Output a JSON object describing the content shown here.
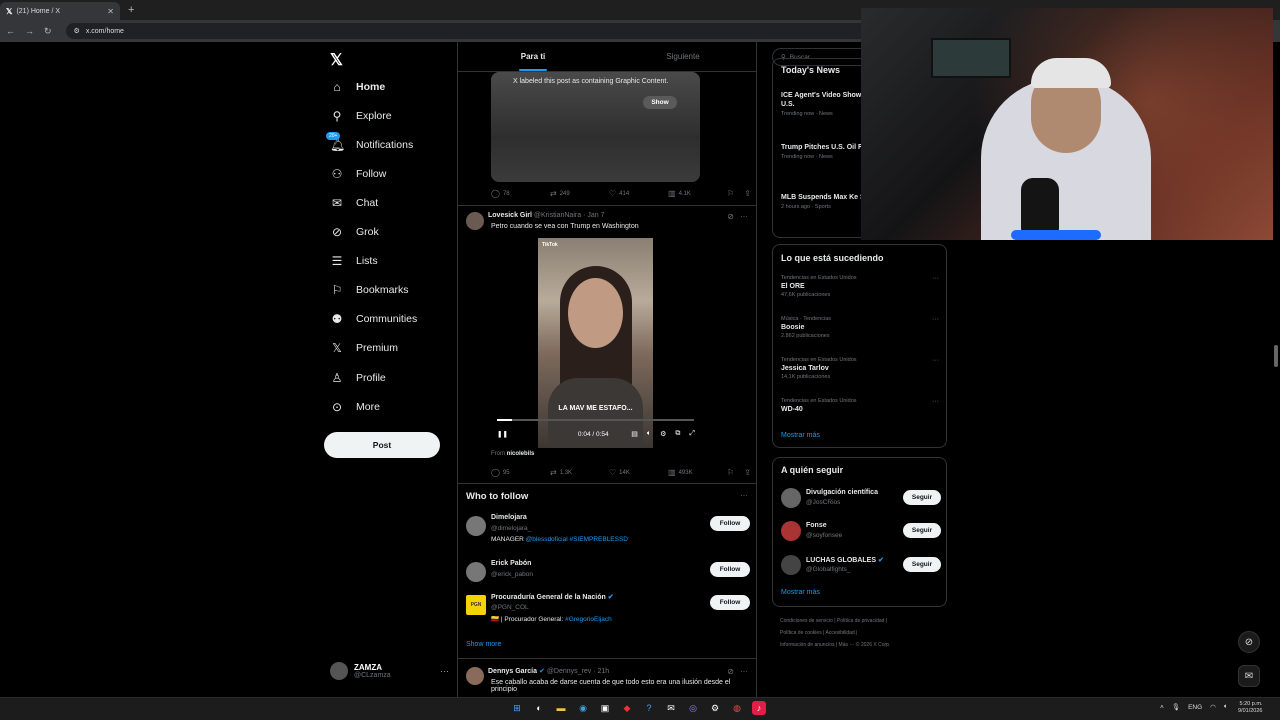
{
  "browser": {
    "tab_title": "(21) Home / X",
    "url": "x.com/home"
  },
  "nav": {
    "items": [
      {
        "label": "Home",
        "icon": "home-icon"
      },
      {
        "label": "Explore",
        "icon": "search-icon"
      },
      {
        "label": "Notifications",
        "icon": "bell-icon",
        "badge": "20+"
      },
      {
        "label": "Follow",
        "icon": "person-plus-icon"
      },
      {
        "label": "Chat",
        "icon": "mail-icon"
      },
      {
        "label": "Grok",
        "icon": "grok-icon"
      },
      {
        "label": "Lists",
        "icon": "list-icon"
      },
      {
        "label": "Bookmarks",
        "icon": "bookmark-icon"
      },
      {
        "label": "Communities",
        "icon": "people-icon"
      },
      {
        "label": "Premium",
        "icon": "x-icon"
      },
      {
        "label": "Profile",
        "icon": "person-icon"
      },
      {
        "label": "More",
        "icon": "more-circle-icon"
      }
    ],
    "post_label": "Post",
    "account": {
      "name": "ZAMZA",
      "handle": "@CLzamza"
    }
  },
  "feed": {
    "tabs": [
      "Para ti",
      "Siguiente"
    ],
    "graphic_post": {
      "notice": "X labeled this post as containing Graphic Content.",
      "show_label": "Show",
      "replies": "78",
      "reposts": "249",
      "likes": "414",
      "views": "4.1K"
    },
    "video_post": {
      "name": "Lovesick Girl",
      "handle": "@KristianNaira",
      "date": "· Jan 7",
      "text": "Petro cuando se vea con Trump en Washington",
      "video_caption": "LA MAV ME ESTAFO...",
      "tiktok": "TikTok",
      "time": "0:04 / 0:54",
      "progress": 0.074,
      "from_label": "From",
      "from_user": "nicolebils",
      "replies": "95",
      "reposts": "1.3K",
      "likes": "14K",
      "views": "493K"
    },
    "who_to_follow": {
      "title": "Who to follow",
      "users": [
        {
          "name": "Dimelojara",
          "handle": "@dimelojara_",
          "bio_prefix": "MANAGER ",
          "bio_links": "@blessdoficial #SIEMPREBLESSD",
          "bio_suffix": "",
          "button": "Follow"
        },
        {
          "name": "Erick Pabón",
          "handle": "@erick_pabon",
          "bio_prefix": "",
          "bio_links": "",
          "bio_suffix": "",
          "button": "Follow"
        },
        {
          "name": "Procuraduría General de la Nación",
          "handle": "@PGN_COL",
          "bio_prefix": "🇨🇴 | Procurador General: ",
          "bio_links": "#GregorioEljach",
          "bio_suffix": "",
          "button": "Follow",
          "avatar_text": "PGN"
        }
      ],
      "show_more": "Show more"
    },
    "last_post": {
      "name": "Dennys García",
      "handle": "@Dennys_rev · 21h",
      "text": "Ese caballo acaba de darse cuenta de que todo esto era una ilusión desde el principio"
    }
  },
  "right": {
    "search_placeholder": "Buscar",
    "todays_news": {
      "title": "Today's News",
      "items": [
        {
          "title": "ICE Agent's Video Shows Confrontation with U.S.",
          "meta": "Trending now · News"
        },
        {
          "title": "Trump Pitches U.S. Oil Reviving Venezuela's E",
          "meta": "Trending now · News"
        },
        {
          "title": "MLB Suspends Max Ke Steroid Violation",
          "meta": "2 hours ago · Sports"
        }
      ]
    },
    "trends": {
      "title": "Lo que está sucediendo",
      "items": [
        {
          "context": "Tendencias en Estados Unidos",
          "name": "El ORE",
          "posts": "47,6K publicaciones"
        },
        {
          "context": "Música · Tendencias",
          "name": "Boosie",
          "posts": "2.862 publicaciones"
        },
        {
          "context": "Tendencias en Estados Unidos",
          "name": "Jessica Tarlov",
          "posts": "14,1K publicaciones"
        },
        {
          "context": "Tendencias en Estados Unidos",
          "name": "WD-40",
          "posts": ""
        }
      ],
      "more": "Mostrar más"
    },
    "who_to_follow": {
      "title": "A quién seguir",
      "users": [
        {
          "name": "Divulgación científica",
          "handle": "@JosCRios",
          "button": "Seguir"
        },
        {
          "name": "Fonse",
          "handle": "@soyfonsee",
          "button": "Seguir"
        },
        {
          "name": "LUCHAS GLOBALES",
          "handle": "@Globalfights_",
          "button": "Seguir",
          "verified": true
        }
      ],
      "more": "Mostrar más"
    },
    "footer": {
      "line1": "Condiciones de servicio  |  Política de privacidad  |",
      "line2": "Política de cookies  |  Accesibilidad  |",
      "line3": "Información de anuncios  |  Más ···  © 2026 X Corp."
    }
  },
  "taskbar": {
    "lang": "ENG",
    "time": "5:20 p.m.",
    "date": "9/01/2026"
  }
}
